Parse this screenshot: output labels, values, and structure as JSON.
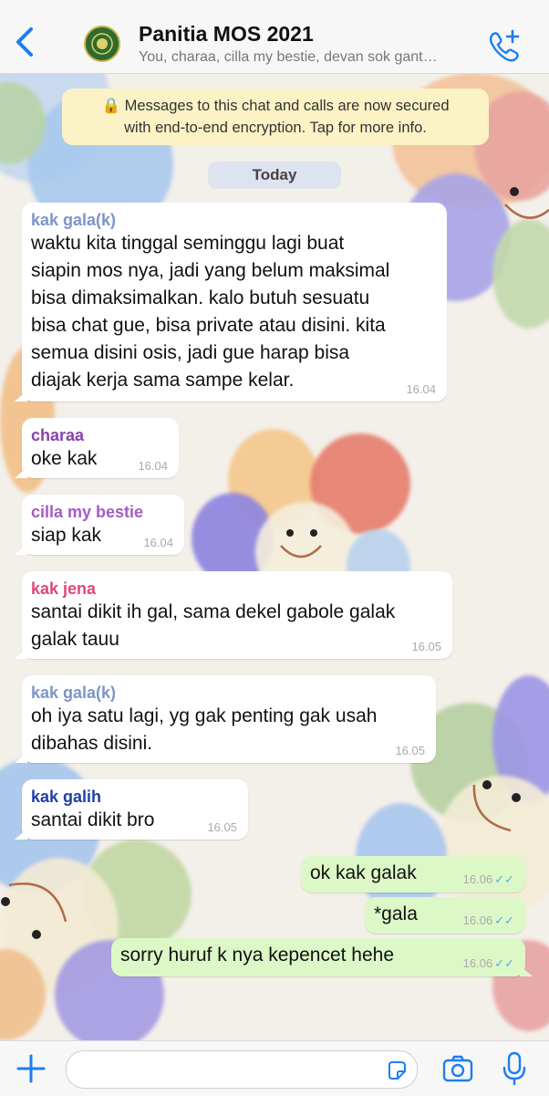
{
  "header": {
    "title": "Panitia MOS 2021",
    "subtitle": "You, charaa, cilla my bestie, devan sok gant…",
    "back_icon": "chevron-left-icon",
    "call_icon": "phone-plus-icon"
  },
  "encryption_notice": {
    "line1": "Messages to this chat and calls are now secured",
    "line2": "with end-to-end encryption. Tap for more info."
  },
  "date_separator": "Today",
  "messages": [
    {
      "sender": "kak gala(k)",
      "sender_color": "#7d95c9",
      "lines": [
        "waktu kita tinggal seminggu lagi buat",
        "siapin mos nya, jadi yang belum maksimal",
        "bisa dimaksimalkan. kalo butuh sesuatu",
        "bisa chat gue, bisa private atau disini. kita",
        "semua disini osis, jadi gue harap bisa",
        "diajak kerja sama sampe kelar."
      ],
      "time": "16.04"
    },
    {
      "sender": "charaa",
      "sender_color": "#8b3fb0",
      "lines": [
        "oke kak"
      ],
      "time": "16.04"
    },
    {
      "sender": "cilla my bestie",
      "sender_color": "#a55bc4",
      "lines": [
        "siap kak"
      ],
      "time": "16.04"
    },
    {
      "sender": "kak jena",
      "sender_color": "#e0457b",
      "lines": [
        "santai dikit ih gal, sama dekel gabole galak",
        "galak tauu"
      ],
      "time": "16.05"
    },
    {
      "sender": "kak gala(k)",
      "sender_color": "#7d95c9",
      "lines": [
        "oh iya satu lagi, yg gak penting gak usah",
        "dibahas disini."
      ],
      "time": "16.05"
    },
    {
      "sender": "kak galih",
      "sender_color": "#1f3fa8",
      "lines": [
        "santai dikit bro"
      ],
      "time": "16.05"
    },
    {
      "sender": "",
      "lines": [
        "ok kak galak"
      ],
      "time": "16.06",
      "outgoing": true
    },
    {
      "sender": "",
      "lines": [
        "*gala"
      ],
      "time": "16.06",
      "outgoing": true
    },
    {
      "sender": "",
      "lines": [
        "sorry huruf k nya kepencet hehe"
      ],
      "time": "16.06",
      "outgoing": true
    }
  ],
  "read_receipt": "✓✓",
  "footer": {
    "plus_icon": "plus-icon",
    "sticker_icon": "sticker-icon",
    "camera_icon": "camera-icon",
    "mic_icon": "microphone-icon"
  }
}
